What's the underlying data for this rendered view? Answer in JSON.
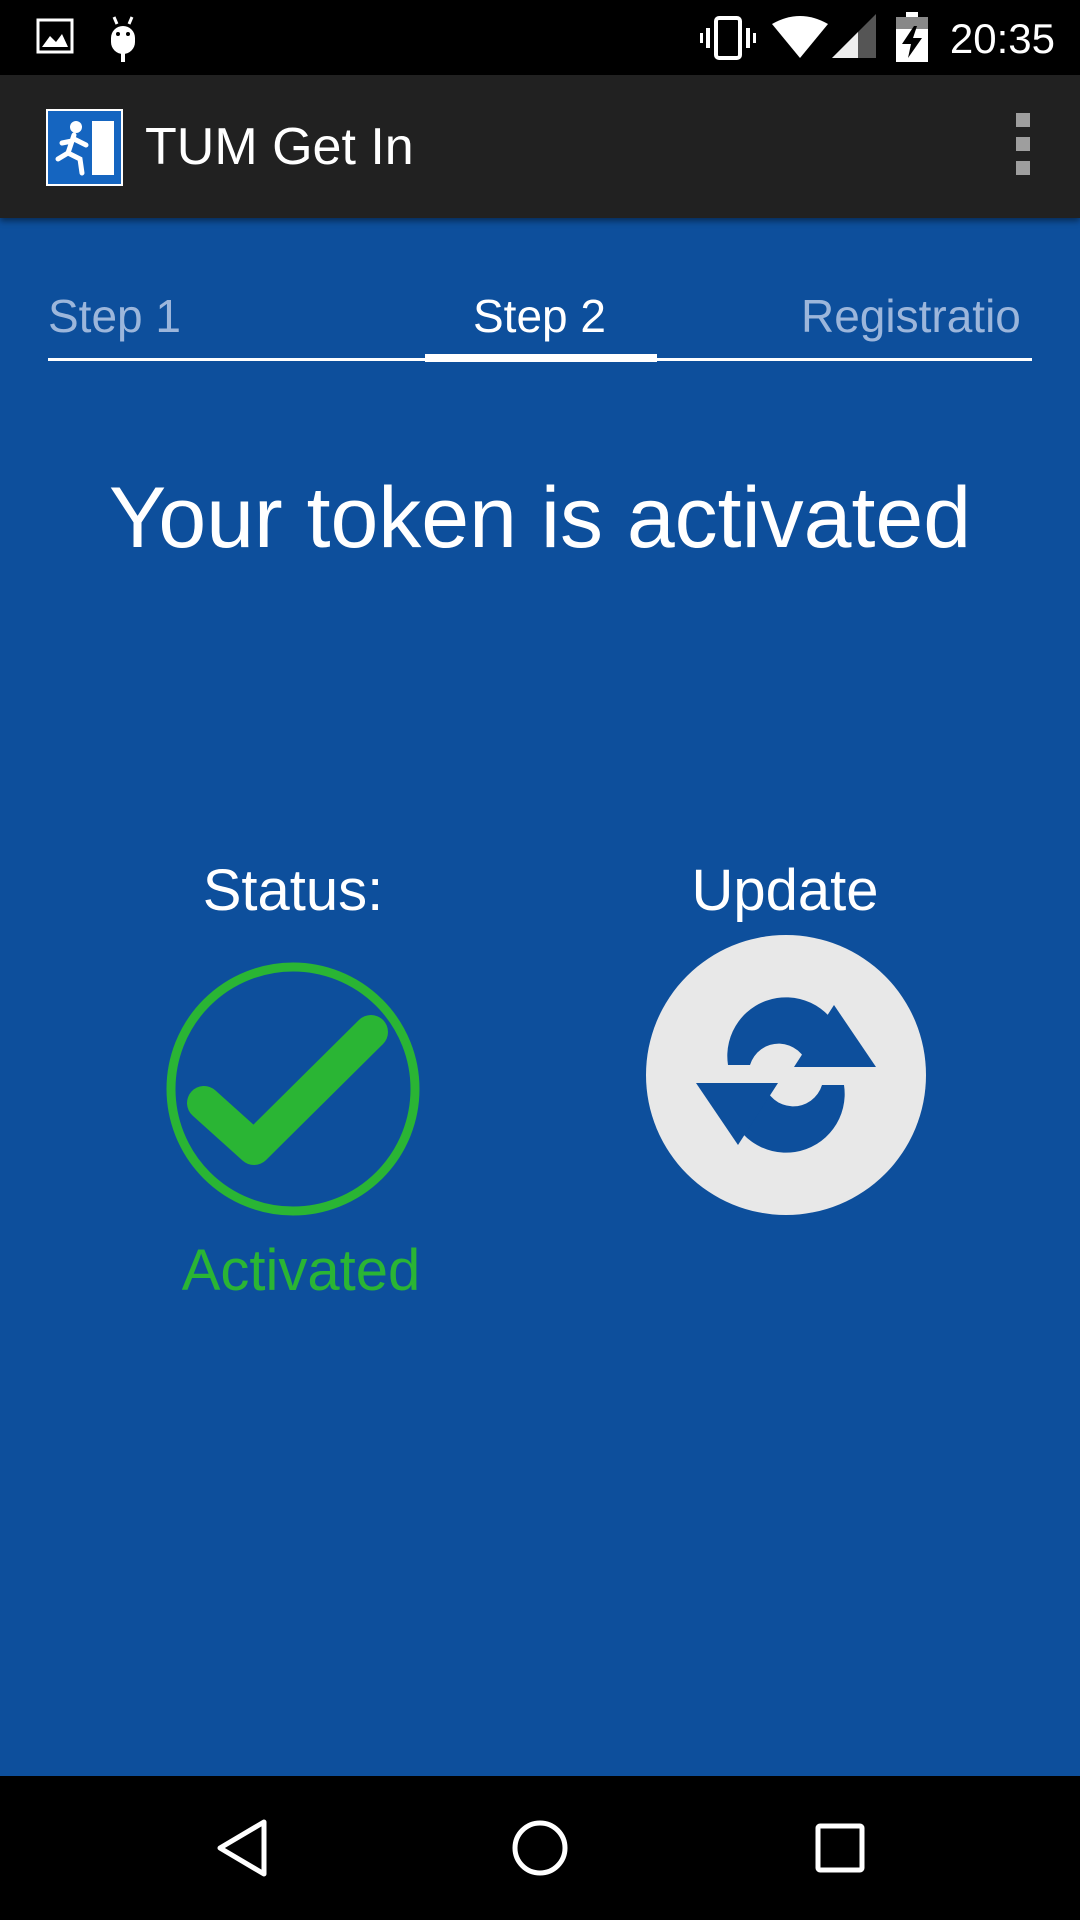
{
  "status_bar": {
    "time": "20:35",
    "icons": [
      "image-icon",
      "android-debug-icon",
      "vibrate-icon",
      "wifi-icon",
      "signal-icon",
      "battery-charging-icon"
    ]
  },
  "app_bar": {
    "title": "TUM Get In",
    "logo_icon": "exit-running-man-icon",
    "menu_icon": "overflow-menu-icon"
  },
  "tabs": [
    {
      "label": "Step 1",
      "active": false
    },
    {
      "label": "Step 2",
      "active": true
    },
    {
      "label": "Registratio",
      "active": false
    }
  ],
  "main": {
    "heading": "Your token is activated",
    "status": {
      "label": "Status:",
      "value": "Activated",
      "icon": "check-circle-icon",
      "color": "#2ab534"
    },
    "update": {
      "label": "Update",
      "icon": "refresh-icon"
    }
  },
  "nav_bar": {
    "icons": [
      "back-icon",
      "home-icon",
      "recents-icon"
    ]
  },
  "colors": {
    "background": "#0d4f9c",
    "app_bar": "#212121",
    "status_green": "#2ab534",
    "inactive_tab": "#9cb6db"
  }
}
